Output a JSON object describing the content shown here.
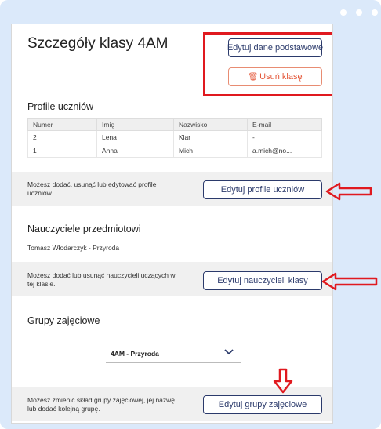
{
  "page": {
    "title": "Szczegóły klasy 4AM",
    "edit_basic_label": "Edytuj dane podstawowe",
    "delete_class_label": "Usuń klasę"
  },
  "students": {
    "heading": "Profile uczniów",
    "columns": [
      "Numer",
      "Imię",
      "Nazwisko",
      "E-mail"
    ],
    "rows": [
      [
        "2",
        "Lena",
        "Klar",
        "-"
      ],
      [
        "1",
        "Anna",
        "Mich",
        "a.mich@no..."
      ]
    ],
    "info": "Możesz dodać, usunąć lub edytować profile uczniów.",
    "edit_label": "Edytuj profile uczniów"
  },
  "teachers": {
    "heading": "Nauczyciele przedmiotowi",
    "entry": "Tomasz Włodarczyk - Przyroda",
    "info": "Możesz dodać lub usunąć nauczycieli uczących w tej klasie.",
    "edit_label": "Edytuj nauczycieli klasy"
  },
  "groups": {
    "heading": "Grupy zajęciowe",
    "selected": "4AM - Przyroda",
    "info": "Możesz zmienić skład grupy zajęciowej, jej nazwę lub dodać kolejną grupę.",
    "edit_label": "Edytuj grupy zajęciowe"
  },
  "colors": {
    "primary": "#2b3a6b",
    "danger": "#e4583a",
    "highlight": "#e0191f",
    "frame": "#dbe9fa",
    "band": "#f0f0f0"
  },
  "icons": [
    "trash-icon",
    "chevron-down-icon"
  ]
}
